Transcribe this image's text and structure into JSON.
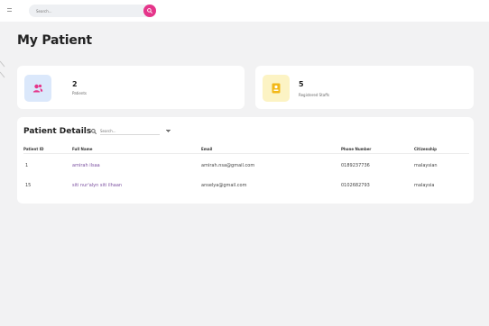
{
  "topbar": {
    "search_placeholder": "Search...",
    "menu_icon": "menu-icon",
    "search_icon": "search-icon"
  },
  "page": {
    "title": "My Patient"
  },
  "stats": [
    {
      "value": "2",
      "label": "Patients",
      "icon": "users-icon",
      "icon_color": "#e5358a",
      "bg_color": "#dbe8fb"
    },
    {
      "value": "5",
      "label": "Registered Staffs",
      "icon": "badge-icon",
      "icon_color": "#f2b818",
      "bg_color": "#fcf3c4"
    }
  ],
  "details": {
    "title": "Patient Details",
    "search_placeholder": "Search...",
    "columns": [
      "Patient ID",
      "Full Name",
      "Email",
      "Phone Number",
      "Citizenship"
    ],
    "rows": [
      {
        "id": "1",
        "name": "amirah ilsaa",
        "email": "amirah.nsa@gmail.com",
        "phone": "0189237736",
        "citizenship": "malaysian"
      },
      {
        "id": "15",
        "name": "siti nur'alyn siti ilhaan",
        "email": "anselya@gmail.com",
        "phone": "0102682793",
        "citizenship": "malaysia"
      }
    ]
  },
  "colors": {
    "accent": "#e5358a",
    "link": "#7b4fa0",
    "background": "#f2f2f3"
  }
}
